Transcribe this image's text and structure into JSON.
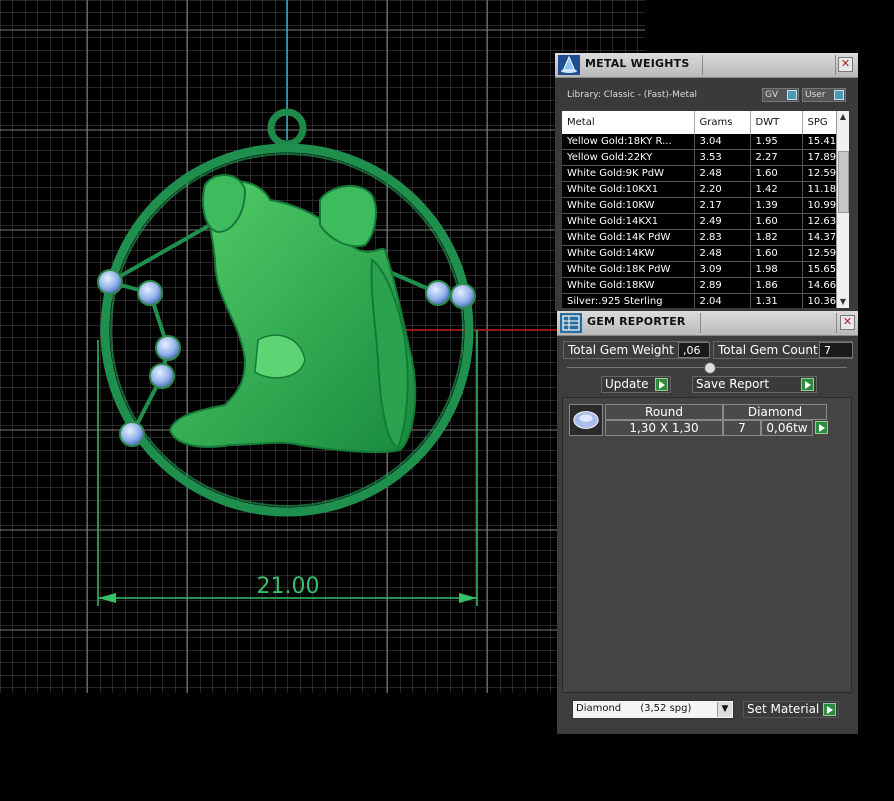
{
  "viewport": {
    "dimension_label": "21.00",
    "colors": {
      "background": "#000000",
      "grid": "#6b6b6b",
      "model": "#1f9a52",
      "gem": "#8fb4ef",
      "dimension": "#35c06a"
    }
  },
  "metal_weights": {
    "title": "METAL WEIGHTS",
    "icon": "rhino-jewel-icon",
    "library": "Library: Classic - (Fast)-Metal",
    "gv_label": "GV",
    "user_label": "User",
    "headers": [
      "Metal",
      "Grams",
      "DWT",
      "SPG"
    ],
    "rows": [
      [
        "Yellow Gold:18KY R...",
        "3.04",
        "1.95",
        "15.41"
      ],
      [
        "Yellow Gold:22KY",
        "3.53",
        "2.27",
        "17.89"
      ],
      [
        "White Gold:9K PdW",
        "2.48",
        "1.60",
        "12.59"
      ],
      [
        "White Gold:10KX1",
        "2.20",
        "1.42",
        "11.18"
      ],
      [
        "White Gold:10KW",
        "2.17",
        "1.39",
        "10.99"
      ],
      [
        "White Gold:14KX1",
        "2.49",
        "1.60",
        "12.63"
      ],
      [
        "White Gold:14K PdW",
        "2.83",
        "1.82",
        "14.37"
      ],
      [
        "White Gold:14KW",
        "2.48",
        "1.60",
        "12.59"
      ],
      [
        "White Gold:18K PdW",
        "3.09",
        "1.98",
        "15.65"
      ],
      [
        "White Gold:18KW",
        "2.89",
        "1.86",
        "14.66"
      ],
      [
        "Silver:.925 Sterling",
        "2.04",
        "1.31",
        "10.36"
      ]
    ]
  },
  "gem_reporter": {
    "title": "GEM REPORTER",
    "icon": "gem-report-icon",
    "total_weight_label": "Total Gem Weight",
    "total_weight_value": ",06",
    "total_count_label": "Total Gem Count",
    "total_count_value": "7",
    "update_label": "Update",
    "save_label": "Save Report",
    "gem": {
      "icon": "round-gem-icon",
      "shape": "Round",
      "material": "Diamond",
      "size": "1,30 X 1,30",
      "count": "7",
      "weight": "0,06tw"
    },
    "material_select": "Diamond      (3,52 spg)",
    "set_material_label": "Set Material"
  }
}
